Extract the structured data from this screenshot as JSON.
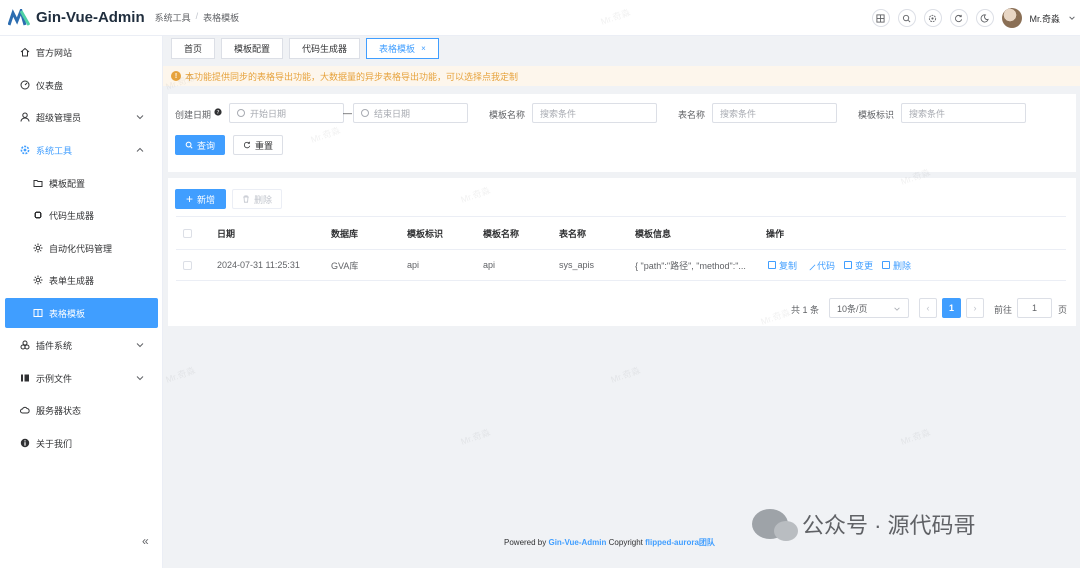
{
  "header": {
    "app_title": "Gin-Vue-Admin",
    "breadcrumb": [
      "系统工具",
      "表格模板"
    ],
    "breadcrumb_sep": "/",
    "user_name": "Mr.奇淼",
    "icons": [
      "layout-icon",
      "search-icon",
      "settings-icon",
      "refresh-icon",
      "moon-icon"
    ]
  },
  "sidebar": {
    "items": [
      {
        "label": "官方网站",
        "icon": "home-icon"
      },
      {
        "label": "仪表盘",
        "icon": "dashboard-icon"
      },
      {
        "label": "超级管理员",
        "icon": "user-icon",
        "chevron": "down"
      },
      {
        "label": "系统工具",
        "icon": "gear-icon",
        "chevron": "up",
        "open": true
      },
      {
        "label": "模板配置",
        "icon": "folder-icon",
        "sub": true
      },
      {
        "label": "代码生成器",
        "icon": "cpu-icon",
        "sub": true
      },
      {
        "label": "自动化代码管理",
        "icon": "sun-icon",
        "sub": true
      },
      {
        "label": "表单生成器",
        "icon": "sun-icon",
        "sub": true
      },
      {
        "label": "表格模板",
        "icon": "book-icon",
        "sub": true,
        "active": true
      },
      {
        "label": "插件系统",
        "icon": "plugin-icon",
        "chevron": "down"
      },
      {
        "label": "示例文件",
        "icon": "file-icon",
        "chevron": "down"
      },
      {
        "label": "服务器状态",
        "icon": "cloud-icon"
      },
      {
        "label": "关于我们",
        "icon": "info-icon"
      }
    ],
    "collapse_label": "«"
  },
  "tabs": [
    {
      "label": "首页"
    },
    {
      "label": "模板配置"
    },
    {
      "label": "代码生成器"
    },
    {
      "label": "表格模板",
      "active": true,
      "closable": "×"
    }
  ],
  "alert": {
    "text": "本功能提供同步的表格导出功能，大数据量的异步表格导出功能，可以选择点我定制"
  },
  "search": {
    "date_label": "创建日期",
    "start_placeholder": "开始日期",
    "end_placeholder": "结束日期",
    "range_sep": "—",
    "template_name_label": "模板名称",
    "template_name_placeholder": "搜索条件",
    "table_name_label": "表名称",
    "table_name_placeholder": "搜索条件",
    "template_id_label": "模板标识",
    "template_id_placeholder": "搜索条件",
    "query_label": "查询",
    "reset_label": "重置"
  },
  "toolbar": {
    "add_label": "新增",
    "delete_label": "删除"
  },
  "table": {
    "columns": [
      "日期",
      "数据库",
      "模板标识",
      "模板名称",
      "表名称",
      "模板信息",
      "操作"
    ],
    "rows": [
      {
        "date": "2024-07-31 11:25:31",
        "db": "GVA库",
        "template_id": "api",
        "template_name": "api",
        "table_name": "sys_apis",
        "info": "{ \"path\":\"路径\", \"method\":\"...",
        "actions": [
          "复制",
          "代码",
          "变更",
          "删除"
        ]
      }
    ]
  },
  "pagination": {
    "total_text": "共 1 条",
    "page_size": "10条/页",
    "current_page": "1",
    "goto_label": "前往",
    "goto_value": "1",
    "page_suffix": "页"
  },
  "footer": {
    "powered_by": "Powered by",
    "project": "Gin-Vue-Admin",
    "copyright": "Copyright",
    "team": "flipped-aurora团队"
  },
  "watermark": {
    "text": "Mr.奇淼"
  },
  "wechat_badge": {
    "text": "公众号 · 源代码哥"
  },
  "colors": {
    "primary": "#409eff",
    "warning": "#e6a23c",
    "warning_bg": "#fdf6ec",
    "page_bg": "#f0f2f5"
  }
}
